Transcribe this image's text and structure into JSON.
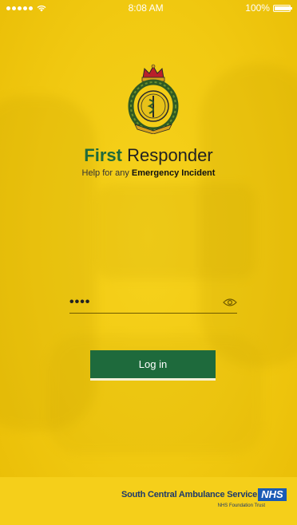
{
  "statusbar": {
    "carrier_signal": "•••••",
    "time": "8:08 AM",
    "battery": "100%"
  },
  "app": {
    "title_bold": "First",
    "title_rest": " Responder",
    "tagline_prefix": "Help for any ",
    "tagline_bold": "Emergency Incident"
  },
  "login": {
    "pin_value": "••••",
    "button_label": "Log in"
  },
  "footer": {
    "organization": "South Central Ambulance Service",
    "nhs_mark": "NHS",
    "trust": "NHS Foundation Trust"
  },
  "colors": {
    "accent_green": "#1e6a3c",
    "brand_yellow": "#f1c911",
    "nhs_blue": "#1a5bb5"
  }
}
